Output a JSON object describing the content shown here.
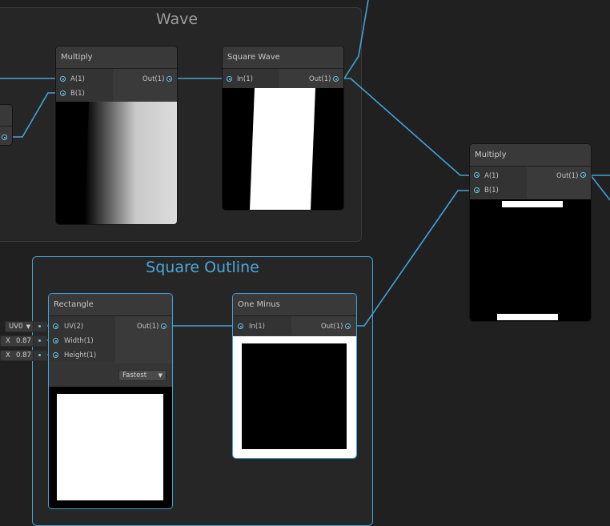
{
  "groups": {
    "wave": {
      "title": "Wave"
    },
    "square_outline": {
      "title": "Square Outline"
    }
  },
  "nodes": {
    "multiply_1": {
      "title": "Multiply",
      "inputs": [
        "A(1)",
        "B(1)"
      ],
      "output": "Out(1)"
    },
    "square_wave": {
      "title": "Square Wave",
      "inputs": [
        "In(1)"
      ],
      "output": "Out(1)"
    },
    "multiply_2": {
      "title": "Multiply",
      "inputs": [
        "A(1)",
        "B(1)"
      ],
      "output": "Out(1)"
    },
    "rectangle": {
      "title": "Rectangle",
      "inputs": [
        "UV(2)",
        "Width(1)",
        "Height(1)"
      ],
      "output": "Out(1)",
      "mode_option": "Fastest"
    },
    "one_minus": {
      "title": "One Minus",
      "inputs": [
        "In(1)"
      ],
      "output": "Out(1)"
    }
  },
  "side_inputs": {
    "uv": "UV0",
    "width_axis": "X",
    "width_value": "0.87",
    "height_axis": "X",
    "height_value": "0.87"
  },
  "colors": {
    "wire": "#44a3d6",
    "selection": "#44a3d6",
    "port": "#6fc9e8"
  }
}
